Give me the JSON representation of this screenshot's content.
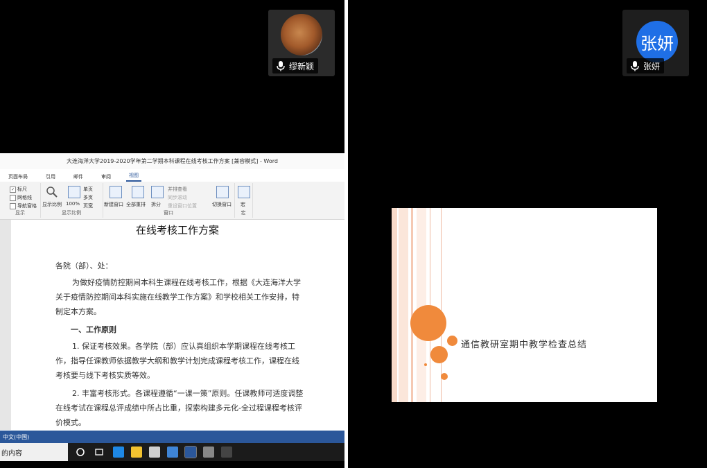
{
  "participants": {
    "left": {
      "name": "缪新颖"
    },
    "right": {
      "name": "张妍",
      "avatar_text": "张妍"
    }
  },
  "word": {
    "title": "大连海洋大学2019-2020学年第二学期本科课程在线考核工作方案 [兼容模式] - Word",
    "tabs": [
      "页面布局",
      "引用",
      "邮件",
      "审阅",
      "视图"
    ],
    "ribbon": {
      "show_items": [
        "标尺",
        "网格线",
        "导航窗格"
      ],
      "show_group_label": "显示",
      "zoom_label": "显示比例",
      "zoom_100": "100%",
      "page_single": "单页",
      "page_multi": "多页",
      "page_width": "页宽",
      "zoom_group_label": "显示比例",
      "new_window": "新建窗口",
      "arrange_all": "全部重排",
      "split": "拆分",
      "side_by_side": "并排查看",
      "sync_scroll": "同步滚动",
      "reset_window": "重设窗口位置",
      "switch_window": "切换窗口",
      "window_group_label": "窗口",
      "macro": "宏",
      "macro_group_label": "宏"
    },
    "doc": {
      "heading": "在线考核工作方案",
      "para1": "各院（部）、处：",
      "para2": "为做好疫情防控期间本科生课程在线考核工作，根据《大连海洋大学关于疫情防控期间本科实施在线教学工作方案》和学校相关工作安排，特制定本方案。",
      "section1": "一、工作原则",
      "para3": "1. 保证考核效果。各学院（部）应认真组织本学期课程在线考核工作，指导任课教师依据教学大纲和教学计划完成课程考核工作，课程在线考核要与线下考核实质等效。",
      "para4": "2. 丰富考核形式。各课程遵循“一课一策”原则。任课教师可适度调整在线考试在课程总评成绩中所占比重，探索构建多元化-全过程课程考核评价模式。"
    },
    "status_lang": "中文(中国)"
  },
  "taskbar": {
    "search_text": "的内容"
  },
  "slide": {
    "title": "通信教研室期中教学检查总结",
    "accent": "#f08a3c"
  }
}
